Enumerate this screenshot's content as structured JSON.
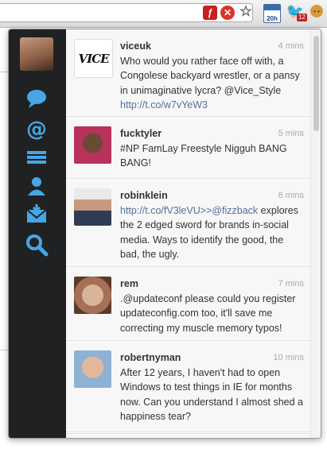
{
  "toolbar": {
    "calendar_label": "20h",
    "notification_count": "12"
  },
  "tweets": [
    {
      "user": "viceuk",
      "time": "4 mins",
      "text": "Who would you rather face off with, a Congolese backyard wrestler, or a pansy in unimaginative lycra? @Vice_Style",
      "link": "http://t.co/w7vYeW3",
      "avatar_text": "VICE"
    },
    {
      "user": "fucktyler",
      "time": "5 mins",
      "text": "#NP FamLay Freestyle Nigguh BANG BANG!",
      "link": ""
    },
    {
      "user": "robinklein",
      "time": "6 mins",
      "link": "http://t.co/fV3leVU>>@fizzback",
      "text": " explores the 2 edged sword for brands in-social media. Ways to identify the good, the bad, the ugly."
    },
    {
      "user": "rem",
      "time": "7 mins",
      "text": ".@updateconf please could you register updateconfig.com too, it'll save me correcting my muscle memory typos!",
      "link": ""
    },
    {
      "user": "robertnyman",
      "time": "10 mins",
      "text": "After 12 years, I haven't had to open Windows to test things in IE for months now. Can you understand I almost shed a happiness tear?",
      "link": ""
    }
  ],
  "sidebar": {
    "items": [
      {
        "name": "timeline-icon"
      },
      {
        "name": "mentions-icon"
      },
      {
        "name": "lists-icon"
      },
      {
        "name": "profile-icon"
      },
      {
        "name": "messages-icon"
      },
      {
        "name": "search-icon"
      }
    ]
  },
  "colors": {
    "sidebar_bg": "#202122",
    "icon_blue": "#46a6e6",
    "link": "#53719a"
  }
}
